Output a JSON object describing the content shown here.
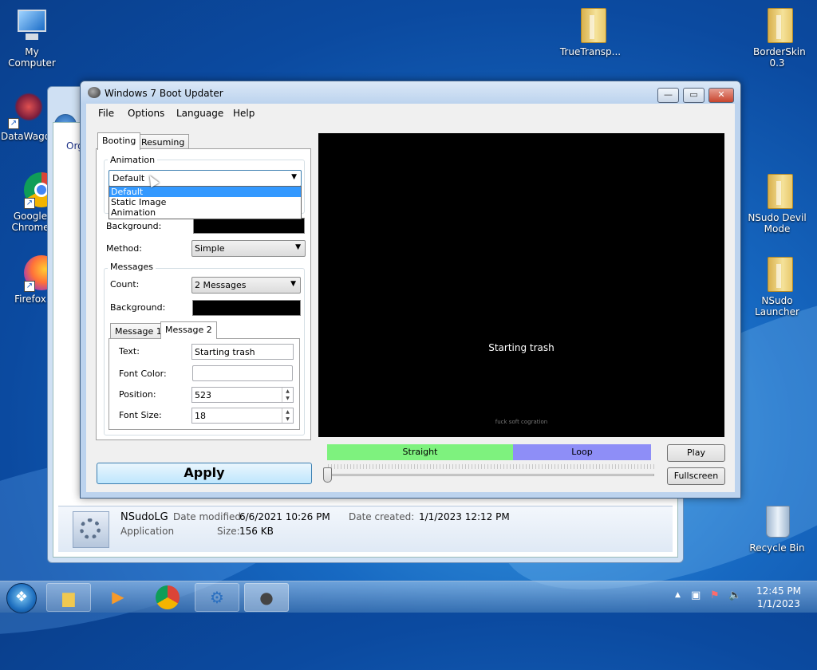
{
  "desktop": {
    "icons_left": [
      {
        "label": "My Computer",
        "icon": "computer-icon"
      },
      {
        "label": "DataWago",
        "icon": "datawago-icon"
      },
      {
        "label": "Google Chrome",
        "icon": "chrome-icon"
      },
      {
        "label": "Firefox",
        "icon": "firefox-icon"
      }
    ],
    "icons_right": [
      {
        "label": "TrueTransp...",
        "icon": "folder-icon"
      },
      {
        "label": "BorderSkin 0.3",
        "icon": "folder-icon"
      },
      {
        "label": "NSudo Devil Mode",
        "icon": "folder-icon"
      },
      {
        "label": "NSudo Launcher",
        "icon": "folder-icon"
      },
      {
        "label": "Recycle Bin",
        "icon": "recycle-bin-icon"
      }
    ]
  },
  "explorer": {
    "org_label": "Org",
    "file": {
      "name": "NSudoLG",
      "type": "Application",
      "date_modified_label": "Date modified:",
      "date_modified": "6/6/2021 10:26 PM",
      "date_created_label": "Date created:",
      "date_created": "1/1/2023 12:12 PM",
      "size_label": "Size:",
      "size": "156 KB"
    }
  },
  "app": {
    "title": "Windows 7 Boot Updater",
    "window_buttons": {
      "minimize": "—",
      "maximize": "▭",
      "close": "✕"
    },
    "menu": [
      "File",
      "Options",
      "Language",
      "Help"
    ],
    "tabs": [
      "Booting",
      "Resuming"
    ],
    "animation": {
      "group_label": "Animation",
      "selected": "Default",
      "options": [
        "Default",
        "Static Image",
        "Animation"
      ]
    },
    "background_label": "Background:",
    "method_label": "Method:",
    "method_value": "Simple",
    "messages": {
      "group_label": "Messages",
      "count_label": "Count:",
      "count_value": "2 Messages",
      "background_label": "Background:",
      "tabs": [
        "Message 1",
        "Message 2"
      ],
      "text_label": "Text:",
      "text_value": "Starting trash",
      "font_color_label": "Font Color:",
      "position_label": "Position:",
      "position_value": "523",
      "font_size_label": "Font Size:",
      "font_size_value": "18"
    },
    "preview": {
      "message": "Starting trash",
      "footer": "fuck soft cogration"
    },
    "playback": {
      "straight_label": "Straight",
      "loop_label": "Loop",
      "straight_color": "#7ef27e",
      "loop_color": "#8e8ef7",
      "play_label": "Play",
      "fullscreen_label": "Fullscreen",
      "slider_position": 0
    },
    "apply_label": "Apply"
  },
  "taskbar": {
    "items": [
      "explorer-icon",
      "media-player-icon",
      "chrome-icon",
      "nsudo-icon",
      "boot-updater-icon"
    ],
    "time": "12:45 PM",
    "date": "1/1/2023",
    "tray_icons": [
      "show-hidden-icons-icon",
      "network-icon",
      "action-center-icon",
      "volume-icon"
    ]
  }
}
